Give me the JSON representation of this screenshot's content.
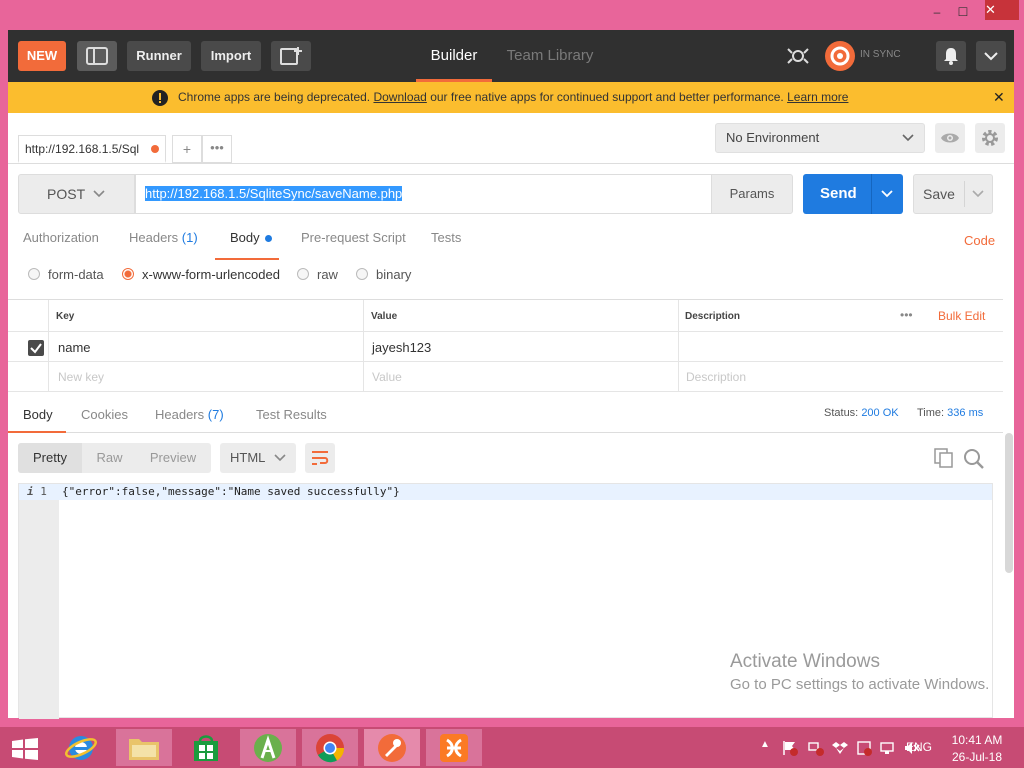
{
  "window": {
    "minimize": "‒",
    "maximize": "☐",
    "close": "✕"
  },
  "appbar": {
    "new_label": "NEW",
    "runner_label": "Runner",
    "import_label": "Import",
    "tabs": [
      "Builder",
      "Team Library"
    ],
    "sync_label": "IN SYNC"
  },
  "banner": {
    "text_before": "Chrome apps are being deprecated.",
    "download_link": "Download",
    "text_after": "our free native apps for continued support and better performance.",
    "learn_more": "Learn more",
    "close": "✕"
  },
  "request_tab": {
    "title": "http://192.168.1.5/Sql",
    "add": "+",
    "more": "•••"
  },
  "environment": {
    "selected": "No Environment"
  },
  "request": {
    "method": "POST",
    "url": "http://192.168.1.5/SqliteSync/saveName.php",
    "params_label": "Params",
    "send_label": "Send",
    "save_label": "Save"
  },
  "request_tabs": {
    "authorization": "Authorization",
    "headers": "Headers",
    "headers_count": "(1)",
    "body": "Body",
    "prerequest": "Pre-request Script",
    "tests": "Tests",
    "code": "Code"
  },
  "body_types": {
    "form_data": "form-data",
    "urlencoded": "x-www-form-urlencoded",
    "raw": "raw",
    "binary": "binary",
    "selected": "x-www-form-urlencoded"
  },
  "kv_table": {
    "headers": {
      "key": "Key",
      "value": "Value",
      "description": "Description",
      "more": "•••",
      "bulk_edit": "Bulk Edit"
    },
    "rows": [
      {
        "checked": true,
        "key": "name",
        "value": "jayesh123",
        "description": ""
      }
    ],
    "placeholders": {
      "key": "New key",
      "value": "Value",
      "description": "Description"
    }
  },
  "response": {
    "tabs": {
      "body": "Body",
      "cookies": "Cookies",
      "headers": "Headers",
      "headers_count": "(7)",
      "tests": "Test Results"
    },
    "status_label": "Status:",
    "status_value": "200 OK",
    "time_label": "Time:",
    "time_value": "336 ms",
    "view_modes": [
      "Pretty",
      "Raw",
      "Preview"
    ],
    "format": "HTML",
    "line_number": "1",
    "line_marker": "i",
    "body_text": "{\"error\":false,\"message\":\"Name saved successfully\"}"
  },
  "watermark": {
    "line1": "Activate Windows",
    "line2": "Go to PC settings to activate Windows."
  },
  "taskbar": {
    "language": "ENG",
    "time": "10:41 AM",
    "date": "26-Jul-18"
  },
  "colors": {
    "accent": "#f26b3a",
    "send": "#1f7be0",
    "banner": "#fbbd2e",
    "appbar": "#303030"
  }
}
